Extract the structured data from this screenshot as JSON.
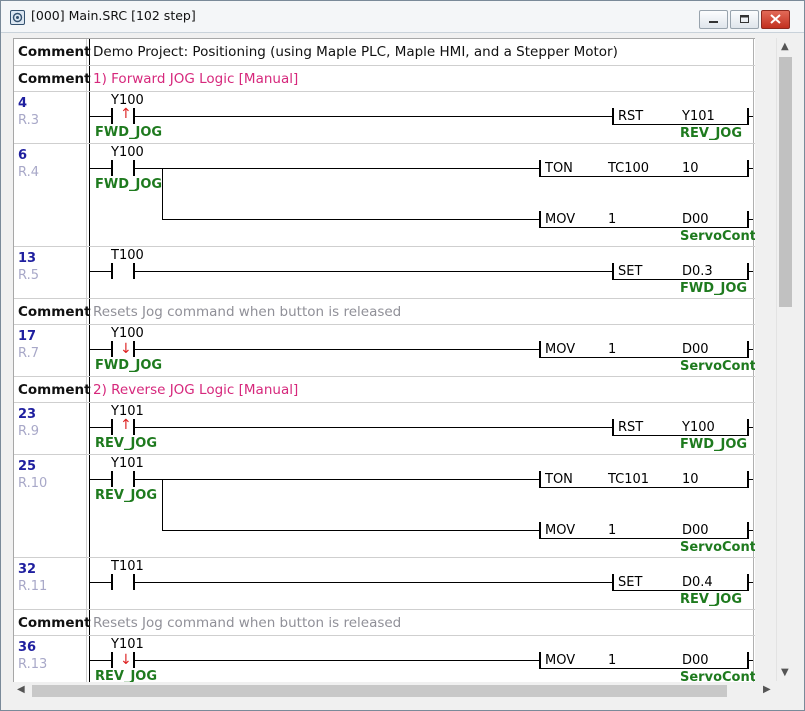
{
  "window": {
    "title": "[000] Main.SRC [102 step]",
    "icon": "app-icon",
    "buttons": [
      "minimize-icon",
      "maximize-icon",
      "close-icon"
    ]
  },
  "comment_label": "Comment",
  "comments": [
    {
      "text": "Demo Project: Positioning (using Maple PLC, Maple HMI, and a Stepper Motor)",
      "color": "#111111"
    },
    {
      "text": "1) Forward JOG Logic [Manual]",
      "color": "#d6287c"
    },
    {
      "text": "Resets Jog command when button is released",
      "color": "#909098"
    },
    {
      "text": "2) Reverse JOG Logic [Manual]",
      "color": "#d6287c"
    },
    {
      "text": "Resets Jog command when button is released",
      "color": "#909098"
    }
  ],
  "rungs": [
    {
      "step": "4",
      "rung": "R.3",
      "contact": "Y100",
      "contact_alias": "FWD_JOG",
      "edge": "rising",
      "instr": [
        {
          "op": "RST",
          "arg1": "",
          "arg2": "Y101",
          "alias": "REV_JOG"
        }
      ]
    },
    {
      "step": "6",
      "rung": "R.4",
      "contact": "Y100",
      "contact_alias": "FWD_JOG",
      "edge": "none",
      "instr": [
        {
          "op": "TON",
          "arg1": "TC100",
          "arg2": "10",
          "alias": ""
        },
        {
          "op": "MOV",
          "arg1": "1",
          "arg2": "D00",
          "alias": "ServoCont"
        }
      ]
    },
    {
      "step": "13",
      "rung": "R.5",
      "contact": "T100",
      "contact_alias": "",
      "edge": "none",
      "instr": [
        {
          "op": "SET",
          "arg1": "",
          "arg2": "D0.3",
          "alias": "FWD_JOG"
        }
      ]
    },
    {
      "step": "17",
      "rung": "R.7",
      "contact": "Y100",
      "contact_alias": "FWD_JOG",
      "edge": "falling",
      "instr": [
        {
          "op": "MOV",
          "arg1": "1",
          "arg2": "D00",
          "alias": "ServoCont"
        }
      ]
    },
    {
      "step": "23",
      "rung": "R.9",
      "contact": "Y101",
      "contact_alias": "REV_JOG",
      "edge": "rising",
      "instr": [
        {
          "op": "RST",
          "arg1": "",
          "arg2": "Y100",
          "alias": "FWD_JOG"
        }
      ]
    },
    {
      "step": "25",
      "rung": "R.10",
      "contact": "Y101",
      "contact_alias": "REV_JOG",
      "edge": "none",
      "instr": [
        {
          "op": "TON",
          "arg1": "TC101",
          "arg2": "10",
          "alias": ""
        },
        {
          "op": "MOV",
          "arg1": "1",
          "arg2": "D00",
          "alias": "ServoCont"
        }
      ]
    },
    {
      "step": "32",
      "rung": "R.11",
      "contact": "T101",
      "contact_alias": "",
      "edge": "none",
      "instr": [
        {
          "op": "SET",
          "arg1": "",
          "arg2": "D0.4",
          "alias": "REV_JOG"
        }
      ]
    },
    {
      "step": "36",
      "rung": "R.13",
      "contact": "Y101",
      "contact_alias": "REV_JOG",
      "edge": "falling",
      "instr": [
        {
          "op": "MOV",
          "arg1": "1",
          "arg2": "D00",
          "alias": "ServoCont"
        }
      ]
    }
  ]
}
